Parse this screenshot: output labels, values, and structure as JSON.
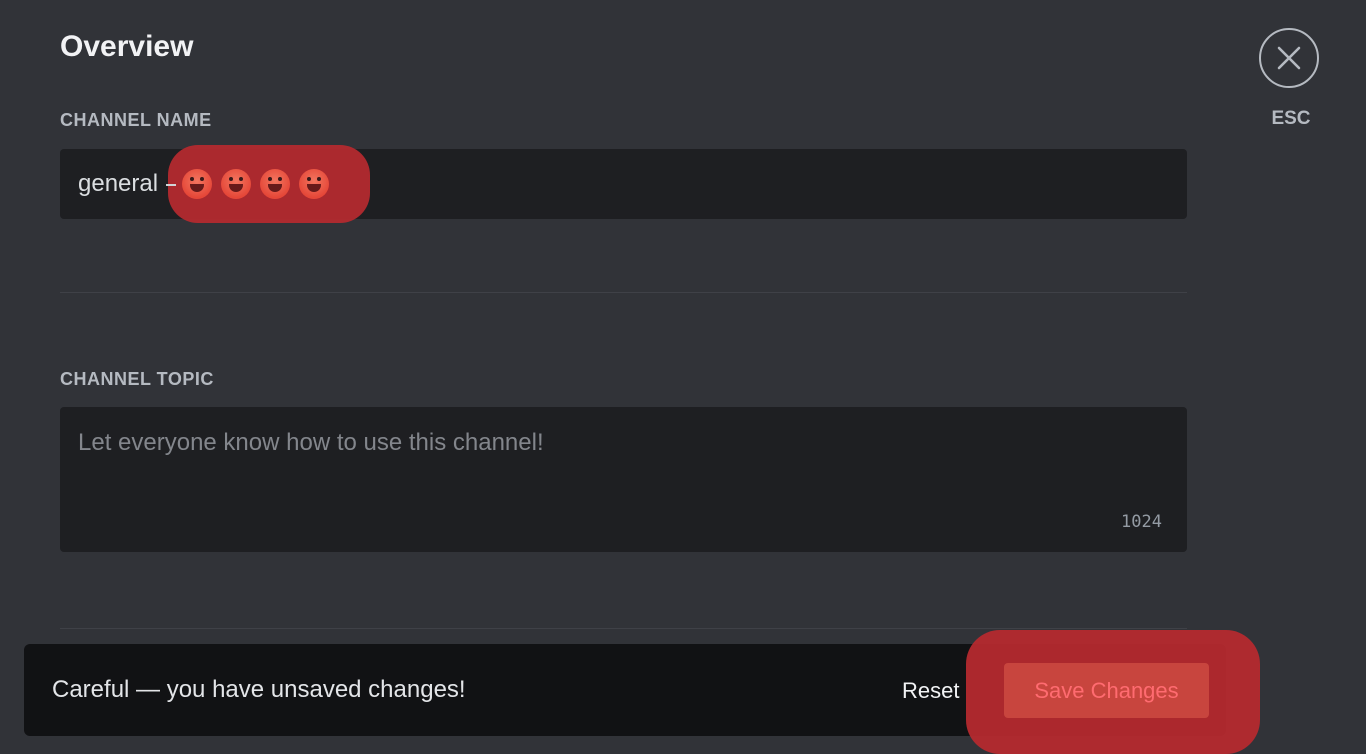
{
  "header": {
    "title": "Overview"
  },
  "close": {
    "icon": "close-icon",
    "label": "ESC"
  },
  "channel_name": {
    "label": "CHANNEL NAME",
    "value": "general",
    "emoji_icon": "grinning-face-icon",
    "emoji_count": 4
  },
  "channel_topic": {
    "label": "CHANNEL TOPIC",
    "placeholder": "Let everyone know how to use this channel!",
    "char_remaining": "1024"
  },
  "unsaved_bar": {
    "message": "Careful — you have unsaved changes!",
    "reset_label": "Reset",
    "save_label": "Save Changes"
  },
  "colors": {
    "background": "#313338",
    "input_bg": "#1e1f22",
    "notice_bg": "#111214",
    "highlight": "#b32a2f",
    "save_button": "#c8453e"
  }
}
